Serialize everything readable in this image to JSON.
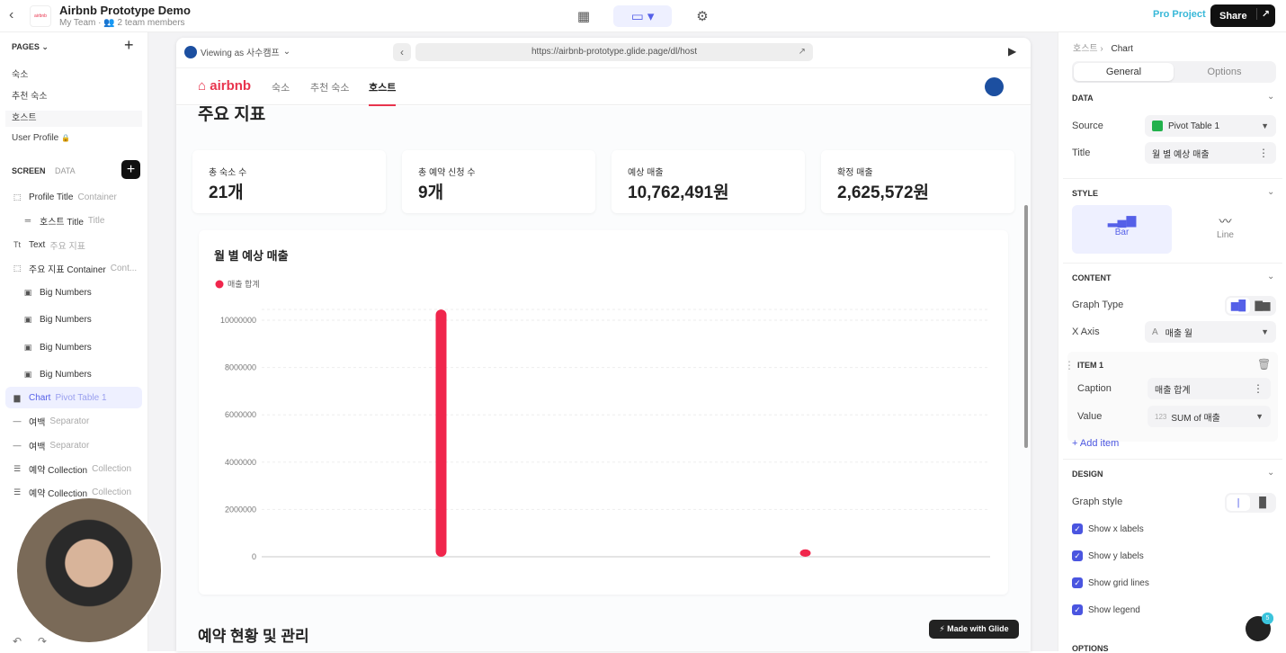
{
  "topbar": {
    "title": "Airbnb Prototype Demo",
    "team": "My Team",
    "members": "2 team members",
    "logo_text": "airbnb",
    "pro": "Pro Project",
    "share": "Share"
  },
  "sidebar": {
    "pages_header": "PAGES",
    "pages": [
      "숙소",
      "추천 숙소",
      "호스트",
      "User Profile"
    ],
    "tabs": [
      "SCREEN",
      "DATA"
    ],
    "layers": [
      {
        "name": "Profile Title",
        "type": "Container",
        "icon": "container-icon"
      },
      {
        "name": "호스트 Title",
        "type": "Title",
        "icon": "title-icon"
      },
      {
        "name": "Text",
        "type": "주요 지표",
        "icon": "text-icon"
      },
      {
        "name": "주요 지표 Container",
        "type": "Cont...",
        "icon": "container-icon"
      },
      {
        "name": "Big Numbers",
        "type": "",
        "icon": "big-numbers-icon"
      },
      {
        "name": "Big Numbers",
        "type": "",
        "icon": "big-numbers-icon"
      },
      {
        "name": "Big Numbers",
        "type": "",
        "icon": "big-numbers-icon"
      },
      {
        "name": "Big Numbers",
        "type": "",
        "icon": "big-numbers-icon"
      },
      {
        "name": "Chart",
        "type": "Pivot Table 1",
        "icon": "chart-icon"
      },
      {
        "name": "여백",
        "type": "Separator",
        "icon": "separator-icon"
      },
      {
        "name": "여백",
        "type": "Separator",
        "icon": "separator-icon"
      },
      {
        "name": "예약 Collection",
        "type": "Collection",
        "icon": "collection-icon"
      },
      {
        "name": "예약 Collection",
        "type": "Collection",
        "icon": "collection-icon"
      }
    ]
  },
  "preview": {
    "viewing": "Viewing as 사수캠프",
    "url": "https://airbnb-prototype.glide.page/dl/host",
    "brand": "airbnb",
    "tabs": [
      "숙소",
      "추천 숙소",
      "호스트"
    ],
    "heading": "주요 지표",
    "cards": [
      {
        "label": "총 숙소 수",
        "value": "21개"
      },
      {
        "label": "총 예약 신청 수",
        "value": "9개"
      },
      {
        "label": "예상 매출",
        "value": "10,762,491원"
      },
      {
        "label": "확정 매출",
        "value": "2,625,572원"
      }
    ],
    "made_with": "Made with Glide",
    "next_heading": "예약 현황 및 관리"
  },
  "chart_data": {
    "type": "bar",
    "title": "월 별 예상 매출",
    "legend": [
      "매출 합계"
    ],
    "legend_placement": "top-left",
    "grid": true,
    "color": "#f0264c",
    "categories": [
      "",
      ""
    ],
    "series": [
      {
        "name": "매출 합계",
        "values": [
          10450000,
          312491
        ]
      }
    ],
    "yticks": [
      0,
      2000000,
      4000000,
      6000000,
      8000000,
      10000000
    ],
    "ylim": [
      0,
      10500000
    ]
  },
  "panel": {
    "crumb_parent": "호스트",
    "crumb_current": "Chart",
    "tabs": [
      "General",
      "Options"
    ],
    "data_h": "DATA",
    "source_l": "Source",
    "source_v": "Pivot Table 1",
    "title_l": "Title",
    "title_v": "월 별 예상 매출",
    "style_h": "STYLE",
    "bar": "Bar",
    "line": "Line",
    "content_h": "CONTENT",
    "graph_type": "Graph Type",
    "xaxis_l": "X Axis",
    "xaxis_v": "매출 월",
    "item_h": "ITEM 1",
    "caption_l": "Caption",
    "caption_v": "매출 합계",
    "value_l": "Value",
    "value_prefix": "123",
    "value_v": "SUM of 매출",
    "add_item": "Add item",
    "design_h": "DESIGN",
    "graph_style": "Graph style",
    "checks": [
      "Show x labels",
      "Show y labels",
      "Show grid lines",
      "Show legend"
    ],
    "options_h": "OPTIONS",
    "notifications": "5",
    "accent": "#4a55e0"
  }
}
